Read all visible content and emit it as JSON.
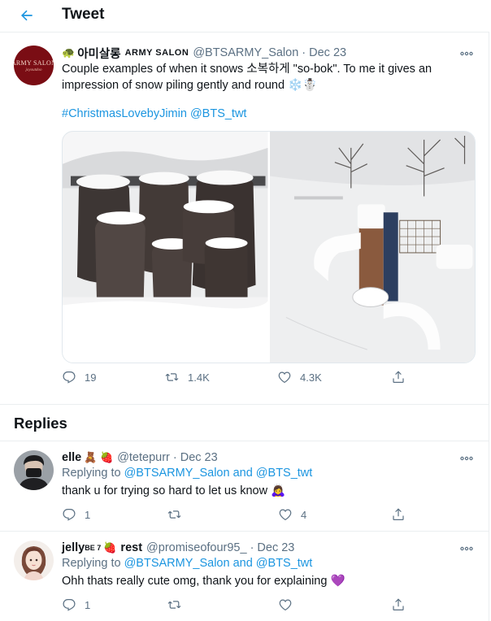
{
  "header": {
    "title": "Tweet"
  },
  "main_tweet": {
    "author_name": "아미살롱",
    "author_name_caps": "ARMY SALON",
    "author_emoji": "🐢",
    "handle": "@BTSARMY_Salon",
    "separator": "·",
    "date": "Dec 23",
    "avatar_text_1": "ARMY SALON",
    "avatar_text_2": "joyoutdoo",
    "text": "Couple examples of when it snows 소복하게 \"so-bok\". To me it gives an impression of snow piling gently and round ❄️☃️",
    "hashtag": "#ChristmasLovebyJimin",
    "mention": "@BTS_twt",
    "reply_count": "19",
    "retweet_count": "1.4K",
    "like_count": "4.3K"
  },
  "replies_title": "Replies",
  "replies": [
    {
      "name": "elle",
      "name_emoji": "🧸 🍓",
      "handle": "@tetepurr",
      "separator": "·",
      "date": "Dec 23",
      "replying_prefix": "Replying to ",
      "replying_to_1": "@BTSARMY_Salon",
      "replying_and": " and ",
      "replying_to_2": "@BTS_twt",
      "text": "thank u for trying so hard to let us know 🙇‍♀️",
      "reply_count": "1",
      "retweet_count": "",
      "like_count": "4"
    },
    {
      "name": "jelly",
      "name_sup": "BE 7",
      "name_emoji": "🍓",
      "name_rest": "rest",
      "handle": "@promiseofour95_",
      "separator": "·",
      "date": "Dec 23",
      "replying_prefix": "Replying to ",
      "replying_to_1": "@BTSARMY_Salon",
      "replying_and": " and ",
      "replying_to_2": "@BTS_twt",
      "text": "Ohh thats really cute omg, thank you for explaining 💜",
      "reply_count": "1",
      "retweet_count": "",
      "like_count": ""
    }
  ],
  "colors": {
    "accent": "#1b95e0",
    "muted_text": "#5b7083",
    "border": "#ebeef0",
    "avatar_main_bg": "#7a0d14"
  },
  "icons": {
    "back": "arrow-left-icon",
    "more": "more-horizontal-icon",
    "reply": "comment-icon",
    "retweet": "retweet-icon",
    "like": "heart-icon",
    "share": "share-icon"
  }
}
